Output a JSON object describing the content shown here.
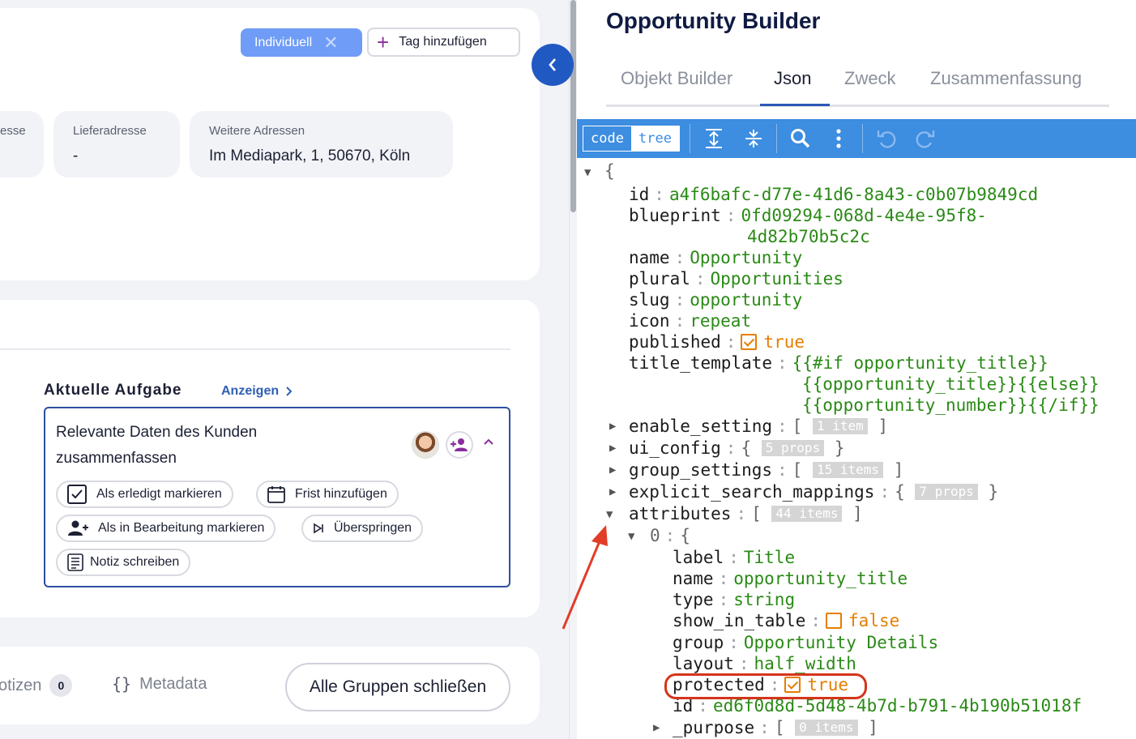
{
  "tags": {
    "individual_label": "Individuell",
    "add_tag_label": "Tag hinzufügen"
  },
  "addresses": [
    {
      "label": "esse",
      "value": ""
    },
    {
      "label": "Lieferadresse",
      "value": "-"
    },
    {
      "label": "Weitere Adressen",
      "value": "Im Mediapark, 1, 50670, Köln"
    }
  ],
  "task": {
    "section_title": "Aktuelle Aufgabe",
    "show_link": "Anzeigen",
    "text": "Relevante Daten des Kunden zusammenfassen",
    "actions": {
      "mark_done": "Als erledigt markieren",
      "add_deadline": "Frist hinzufügen",
      "mark_in_progress": "Als in Bearbeitung markieren",
      "skip": "Überspringen",
      "write_note": "Notiz schreiben"
    }
  },
  "bottom": {
    "notes_label": "otizen",
    "notes_count": "0",
    "metadata_label": "Metadata",
    "close_groups": "Alle Gruppen schließen"
  },
  "builder": {
    "title": "Opportunity Builder",
    "tabs": [
      "Objekt Builder",
      "Json",
      "Zweck",
      "Zusammenfassung"
    ],
    "active_tab": "Json",
    "mode": {
      "code": "code",
      "tree": "tree",
      "active": "code"
    }
  },
  "json_tree": {
    "open_brace": "{",
    "id": "a4f6bafc-d77e-41d6-8a43-c0b07b9849cd",
    "blueprint_1": "0fd09294-068d-4e4e-95f8-",
    "blueprint_2": "4d82b70b5c2c",
    "name": "Opportunity",
    "plural": "Opportunities",
    "slug": "opportunity",
    "icon": "repeat",
    "published": "true",
    "title_template_1": "{{#if opportunity_title}}",
    "title_template_2": "{{opportunity_title}}{{else}}",
    "title_template_3": "{{opportunity_number}}{{/if}}",
    "enable_setting_count": "1 item",
    "ui_config_count": "5 props",
    "group_settings_count": "15 items",
    "explicit_search_mappings_count": "7 props",
    "attributes_count": "44 items",
    "attr0": {
      "index": "0",
      "label": "Title",
      "name": "opportunity_title",
      "type": "string",
      "show_in_table": "false",
      "group": "Opportunity Details",
      "layout": "half_width",
      "protected": "true",
      "id": "ed6f0d8d-5d48-4b7d-b791-4b190b51018f",
      "purpose_count": "0 items"
    }
  },
  "colors": {
    "accent": "#2159c3",
    "toolbar": "#3d8de0",
    "string": "#2a8a16",
    "boolean": "#e67e00",
    "annotation": "#d4351c"
  }
}
